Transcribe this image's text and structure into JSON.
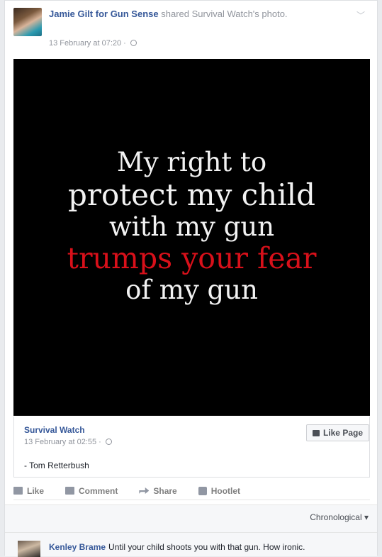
{
  "post": {
    "author": "Jamie Gilt for Gun Sense",
    "action_text": "shared Survival Watch's photo.",
    "timestamp": "13 February at 07:20 ·"
  },
  "image_text": {
    "line1": "My right to",
    "line2": "protect my child",
    "line3": "with my gun",
    "line4": "trumps your fear",
    "line5": "of my gun"
  },
  "shared": {
    "page_name": "Survival Watch",
    "timestamp": "13 February at 02:55 ·",
    "caption": "- Tom Retterbush",
    "like_page_label": "Like Page"
  },
  "actions": {
    "like": "Like",
    "comment": "Comment",
    "share": "Share",
    "hootlet": "Hootlet"
  },
  "comments": {
    "sort_label": "Chronological ▾",
    "items": [
      {
        "name": "Kenley Brame",
        "text": "Until your child shoots you with that gun. How ironic."
      }
    ]
  },
  "colors": {
    "link": "#365899",
    "accent_red": "#d8101a",
    "image_bg": "#000000"
  }
}
